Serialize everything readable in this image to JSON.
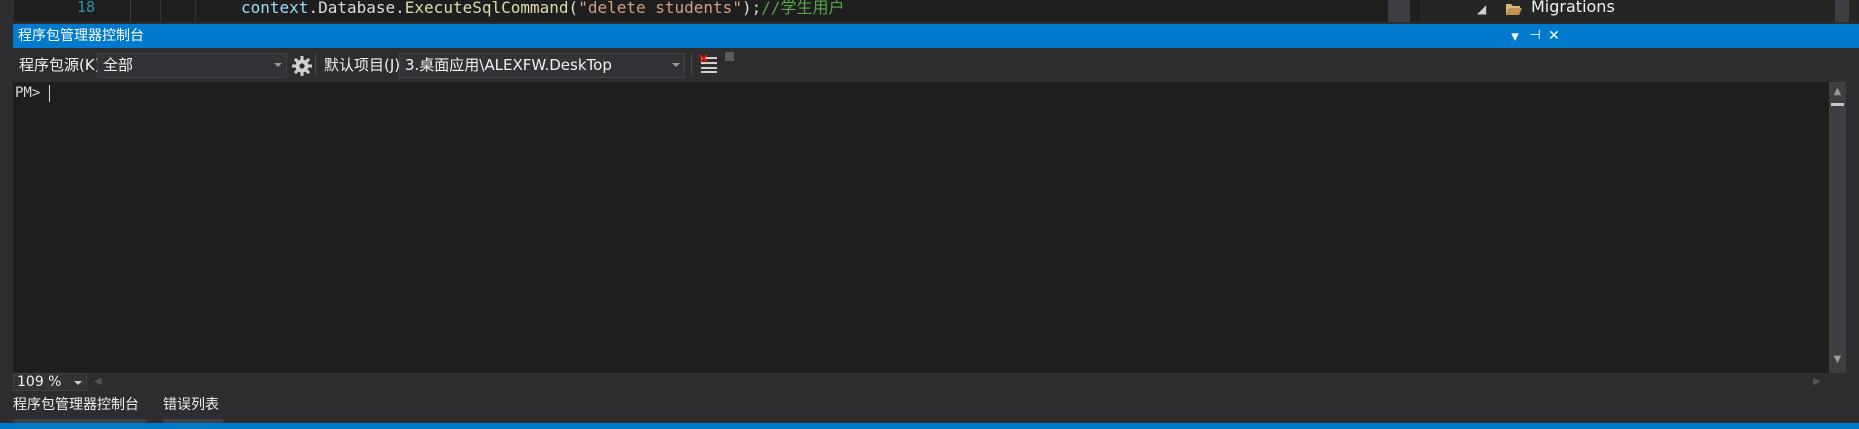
{
  "editor": {
    "line_number": "18",
    "code_line": {
      "id": "context",
      "dot1": ".",
      "prop": "Database",
      "dot2": ".",
      "method": "ExecuteSqlCommand",
      "open": "(",
      "string": "\"delete students\"",
      "close": ");",
      "comment": "//学生用户"
    }
  },
  "solution_explorer": {
    "node_label": "Migrations",
    "expand_glyph": "◢"
  },
  "panel": {
    "title": "程序包管理器控制台",
    "buttons": {
      "dropdown": "▾",
      "pin": "⊣",
      "close": "✕"
    }
  },
  "toolbar": {
    "package_source_label": "程序包源(K):",
    "package_source_value": "全部",
    "default_project_label": "默认项目(J):",
    "default_project_value": "3.桌面应用\\ALEXFW.DeskTop"
  },
  "console": {
    "prompt": "PM>"
  },
  "zoom": {
    "value": "109 %"
  },
  "tabs": [
    {
      "label": "程序包管理器控制台"
    },
    {
      "label": "错误列表"
    }
  ],
  "colors": {
    "accent": "#007acc",
    "background": "#2d2d30",
    "console_bg": "#1e1e1e"
  }
}
